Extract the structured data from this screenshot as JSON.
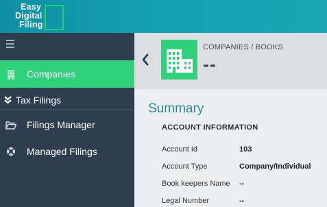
{
  "app": {
    "logo_line1": "Easy",
    "logo_line2": "Digital",
    "logo_line3": "Filing"
  },
  "sidebar": {
    "items": [
      {
        "label": "Companies",
        "icon": "building-icon",
        "active": true
      },
      {
        "label": "Filings Manager",
        "icon": "folder-open-icon"
      },
      {
        "label": "Managed Filings",
        "icon": "lifebuoy-icon"
      }
    ],
    "section_label": "Tax Filings"
  },
  "header": {
    "breadcrumb_companies": "COMPANIES",
    "breadcrumb_separator": " / ",
    "breadcrumb_books": "BOOKS",
    "title": "--"
  },
  "summary": {
    "title": "Summary",
    "section_title": "ACCOUNT INFORMATION",
    "rows": [
      {
        "label": "Account Id",
        "value": "103"
      },
      {
        "label": "Account Type",
        "value": "Company/Individual"
      },
      {
        "label": "Book keepers Name",
        "value": "--"
      },
      {
        "label": "Legal Number",
        "value": "--"
      }
    ]
  },
  "colors": {
    "topbar": "#14a3b4",
    "sidebar": "#2f3e4f",
    "accent_green": "#2fd27a",
    "summary_teal": "#2a8c8f"
  }
}
